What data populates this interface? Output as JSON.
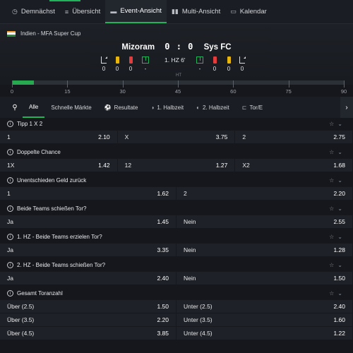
{
  "topnav": {
    "items": [
      {
        "icon": "clock-icon",
        "glyph": "◷",
        "label": "Demnächst"
      },
      {
        "icon": "list-icon",
        "glyph": "≡",
        "label": "Übersicht"
      },
      {
        "icon": "event-view-icon",
        "glyph": "▬",
        "label": "Event-Ansicht",
        "active": true
      },
      {
        "icon": "multi-view-icon",
        "glyph": "▮▮",
        "label": "Multi-Ansicht"
      },
      {
        "icon": "calendar-icon",
        "glyph": "▭",
        "label": "Kalendar"
      }
    ]
  },
  "match": {
    "league": "Indien - MFA Super Cup",
    "home": "Mizoram",
    "away": "Sys FC",
    "score": "0 : 0",
    "period": "1. HZ  6'",
    "home_stats": {
      "corners": "0",
      "yellow": "0",
      "red": "0",
      "possession": "-"
    },
    "away_stats": {
      "possession": "-",
      "red": "0",
      "yellow": "0",
      "corners": "0"
    }
  },
  "timeline": {
    "ht_label": "HT",
    "ticks": [
      "0",
      "15",
      "30",
      "45",
      "60",
      "75",
      "90"
    ],
    "elapsed_minute": 6,
    "total_minutes": 90
  },
  "filters": {
    "tabs": [
      {
        "label": "Alle",
        "active": true,
        "icon": ""
      },
      {
        "label": "Schnelle Märkte",
        "icon": ""
      },
      {
        "label": "Resultate",
        "icon": "ball-icon",
        "glyph": "⚽"
      },
      {
        "label": "1. Halbzeit",
        "icon": "half-icon",
        "glyph": "◑"
      },
      {
        "label": "2. Halbzeit",
        "icon": "half-icon",
        "glyph": "◐"
      },
      {
        "label": "Tor/E",
        "icon": "goal-icon",
        "glyph": "⊏"
      }
    ]
  },
  "markets": [
    {
      "title": "Tipp 1 X 2",
      "rows": [
        [
          {
            "label": "1",
            "odd": "2.10"
          },
          {
            "label": "X",
            "odd": "3.75"
          },
          {
            "label": "2",
            "odd": "2.75"
          }
        ]
      ]
    },
    {
      "title": "Doppelte Chance",
      "rows": [
        [
          {
            "label": "1X",
            "odd": "1.42"
          },
          {
            "label": "12",
            "odd": "1.27"
          },
          {
            "label": "X2",
            "odd": "1.68"
          }
        ]
      ]
    },
    {
      "title": "Unentschieden Geld zurück",
      "rows": [
        [
          {
            "label": "1",
            "odd": "1.62"
          },
          {
            "label": "2",
            "odd": "2.20"
          }
        ]
      ]
    },
    {
      "title": "Beide Teams schießen Tor?",
      "rows": [
        [
          {
            "label": "Ja",
            "odd": "1.45"
          },
          {
            "label": "Nein",
            "odd": "2.55"
          }
        ]
      ]
    },
    {
      "title": "1. HZ - Beide Teams erzielen Tor?",
      "rows": [
        [
          {
            "label": "Ja",
            "odd": "3.35"
          },
          {
            "label": "Nein",
            "odd": "1.28"
          }
        ]
      ]
    },
    {
      "title": "2. HZ - Beide Teams schießen Tor?",
      "rows": [
        [
          {
            "label": "Ja",
            "odd": "2.40"
          },
          {
            "label": "Nein",
            "odd": "1.50"
          }
        ]
      ]
    },
    {
      "title": "Gesamt Toranzahl",
      "rows": [
        [
          {
            "label": "Über (2.5)",
            "odd": "1.50"
          },
          {
            "label": "Unter (2.5)",
            "odd": "2.40"
          }
        ],
        [
          {
            "label": "Über (3.5)",
            "odd": "2.20"
          },
          {
            "label": "Unter (3.5)",
            "odd": "1.60"
          }
        ],
        [
          {
            "label": "Über (4.5)",
            "odd": "3.85"
          },
          {
            "label": "Unter (4.5)",
            "odd": "1.22"
          }
        ]
      ]
    }
  ],
  "colors": {
    "accent": "#1fb45a",
    "background": "#15171c",
    "row": "#1e2127"
  }
}
